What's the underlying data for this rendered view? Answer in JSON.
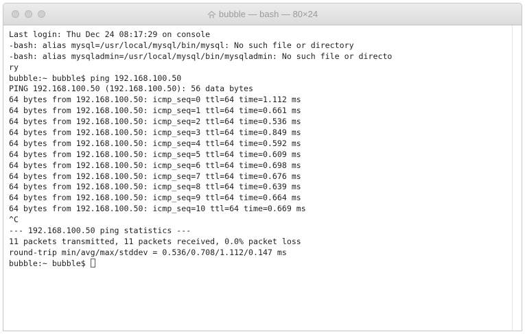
{
  "window": {
    "title": "bubble — bash — 80×24",
    "home_icon": "home-icon"
  },
  "terminal": {
    "lines": [
      "Last login: Thu Dec 24 08:17:29 on console",
      "-bash: alias mysql=/usr/local/mysql/bin/mysql: No such file or directory",
      "-bash: alias mysqladmin=/usr/local/mysql/bin/mysqladmin: No such file or directo",
      "ry",
      "bubble:~ bubble$ ping 192.168.100.50",
      "PING 192.168.100.50 (192.168.100.50): 56 data bytes",
      "64 bytes from 192.168.100.50: icmp_seq=0 ttl=64 time=1.112 ms",
      "64 bytes from 192.168.100.50: icmp_seq=1 ttl=64 time=0.661 ms",
      "64 bytes from 192.168.100.50: icmp_seq=2 ttl=64 time=0.536 ms",
      "64 bytes from 192.168.100.50: icmp_seq=3 ttl=64 time=0.849 ms",
      "64 bytes from 192.168.100.50: icmp_seq=4 ttl=64 time=0.592 ms",
      "64 bytes from 192.168.100.50: icmp_seq=5 ttl=64 time=0.609 ms",
      "64 bytes from 192.168.100.50: icmp_seq=6 ttl=64 time=0.698 ms",
      "64 bytes from 192.168.100.50: icmp_seq=7 ttl=64 time=0.676 ms",
      "64 bytes from 192.168.100.50: icmp_seq=8 ttl=64 time=0.639 ms",
      "64 bytes from 192.168.100.50: icmp_seq=9 ttl=64 time=0.664 ms",
      "64 bytes from 192.168.100.50: icmp_seq=10 ttl=64 time=0.669 ms",
      "^C",
      "--- 192.168.100.50 ping statistics ---",
      "11 packets transmitted, 11 packets received, 0.0% packet loss",
      "round-trip min/avg/max/stddev = 0.536/0.708/1.112/0.147 ms"
    ],
    "prompt": "bubble:~ bubble$ "
  }
}
